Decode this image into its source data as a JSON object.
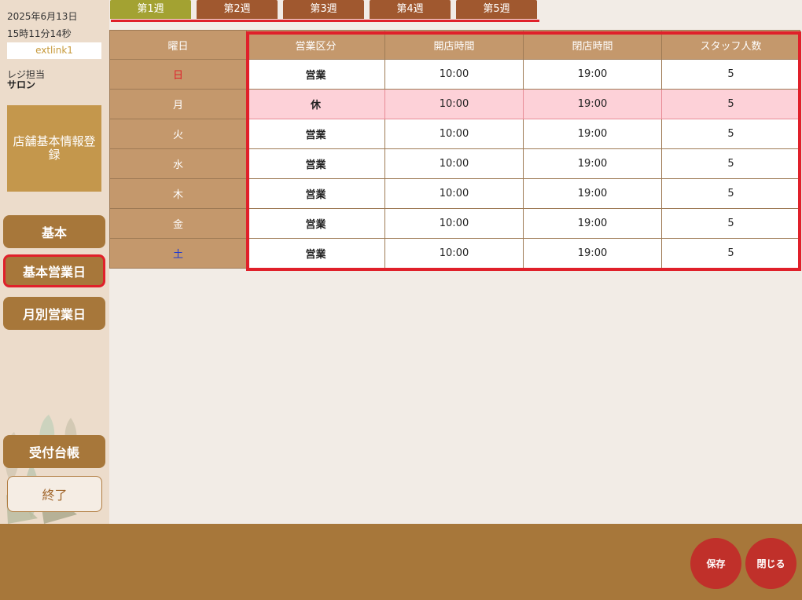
{
  "sidebar": {
    "date": "2025年6月13日",
    "time": "15時11分14秒",
    "link": "extlink1",
    "staff_label": "レジ担当",
    "staff_name": "サロン",
    "store_button": "店舗基本情報登録",
    "nav": [
      "基本",
      "基本営業日",
      "月別営業日"
    ],
    "ledger": "受付台帳",
    "exit": "終了"
  },
  "tabs": [
    "第1週",
    "第2週",
    "第3週",
    "第4週",
    "第5週"
  ],
  "active_tab": 0,
  "table": {
    "headers": [
      "曜日",
      "営業区分",
      "開店時間",
      "閉店時間",
      "スタッフ人数"
    ],
    "rows": [
      {
        "day": "日",
        "status": "営業",
        "open": "10:00",
        "close": "19:00",
        "staff": "5"
      },
      {
        "day": "月",
        "status": "休",
        "open": "10:00",
        "close": "19:00",
        "staff": "5"
      },
      {
        "day": "火",
        "status": "営業",
        "open": "10:00",
        "close": "19:00",
        "staff": "5"
      },
      {
        "day": "水",
        "status": "営業",
        "open": "10:00",
        "close": "19:00",
        "staff": "5"
      },
      {
        "day": "木",
        "status": "営業",
        "open": "10:00",
        "close": "19:00",
        "staff": "5"
      },
      {
        "day": "金",
        "status": "営業",
        "open": "10:00",
        "close": "19:00",
        "staff": "5"
      },
      {
        "day": "土",
        "status": "営業",
        "open": "10:00",
        "close": "19:00",
        "staff": "5"
      }
    ]
  },
  "footer": {
    "save": "保存",
    "close": "閉じる"
  },
  "colors": {
    "accent_brown": "#a7773a",
    "header_tan": "#c4986c",
    "highlight_red": "#e0202a",
    "closed_row": "#fdd1d8",
    "active_tab": "#a3a232"
  }
}
